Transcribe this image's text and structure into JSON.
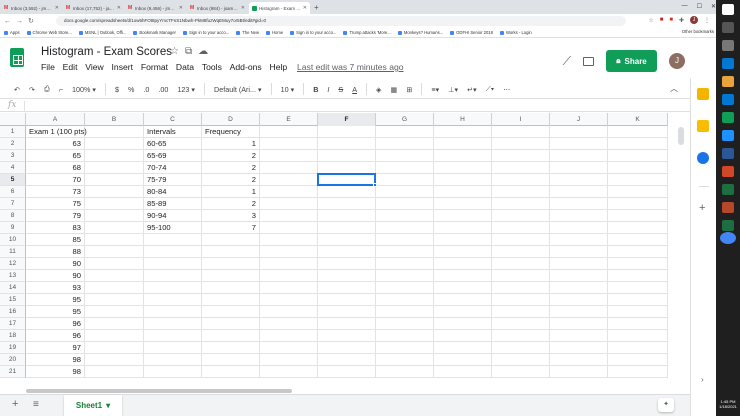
{
  "browser": {
    "tabs": [
      {
        "title": "Inbox (3,592) - jmartin9@easttr...",
        "icon": "M"
      },
      {
        "title": "Inbox (17,752) - jasminson@eas...",
        "icon": "M"
      },
      {
        "title": "Inbox (9,456) - jmartin9@easttr...",
        "icon": "M"
      },
      {
        "title": "Inbox (984) - jsam.martin@ema...",
        "icon": "M"
      },
      {
        "title": "Histogram - Exam Scores - Goo...",
        "icon": "sheets"
      }
    ],
    "new_tab": "+",
    "url": "docs.google.com/spreadsheets/d/1ow5hFOt8pyYmcTFnS1Nbwh-PkM8fuzWqEMuy7or5Bt/edit#gid=0",
    "profile_initial": "J",
    "bookmarks": [
      "Apps",
      "Chrome Web Store...",
      "MSNL | Outlook, Offi...",
      "Bookmark Manager",
      "Sign in to your acco...",
      "The New",
      "Home",
      "Sign in to your acco...",
      "Trump attacks 'More...",
      "Monkeys? Humans...",
      "ODFHI Senior 2018",
      "Works - Login"
    ],
    "other_bookmarks": "Other bookmarks"
  },
  "doc": {
    "title": "Histogram - Exam Scores",
    "menu": [
      "File",
      "Edit",
      "View",
      "Insert",
      "Format",
      "Data",
      "Tools",
      "Add-ons",
      "Help"
    ],
    "last_edit": "Last edit was 7 minutes ago",
    "share_label": "Share",
    "avatar_initial": "J"
  },
  "toolbar": {
    "zoom": "100%",
    "currency": "$",
    "percent": "%",
    "dec_less": ".0",
    "dec_more": ".00",
    "format_more": "123",
    "font": "Default (Ari...",
    "font_size": "10",
    "bold": "B",
    "italic": "I",
    "strike": "S",
    "text_color": "A"
  },
  "formula_bar": {
    "fx": "fx",
    "value": ""
  },
  "grid": {
    "columns": [
      "A",
      "B",
      "C",
      "D",
      "E",
      "F",
      "G",
      "H",
      "I",
      "J",
      "K"
    ],
    "selected_column": "F",
    "selected_row": "5",
    "rows": [
      {
        "n": "1",
        "A": "Exam 1 (100 pts)",
        "C": "Intervals",
        "D": "Frequency"
      },
      {
        "n": "2",
        "A": "63",
        "C": "60-65",
        "D": "1"
      },
      {
        "n": "3",
        "A": "65",
        "C": "65-69",
        "D": "2"
      },
      {
        "n": "4",
        "A": "68",
        "C": "70-74",
        "D": "2"
      },
      {
        "n": "5",
        "A": "70",
        "C": "75-79",
        "D": "2"
      },
      {
        "n": "6",
        "A": "73",
        "C": "80-84",
        "D": "1"
      },
      {
        "n": "7",
        "A": "75",
        "C": "85-89",
        "D": "2"
      },
      {
        "n": "8",
        "A": "79",
        "C": "90-94",
        "D": "3"
      },
      {
        "n": "9",
        "A": "83",
        "C": "95-100",
        "D": "7"
      },
      {
        "n": "10",
        "A": "85"
      },
      {
        "n": "11",
        "A": "88"
      },
      {
        "n": "12",
        "A": "90"
      },
      {
        "n": "13",
        "A": "90"
      },
      {
        "n": "14",
        "A": "93"
      },
      {
        "n": "15",
        "A": "95"
      },
      {
        "n": "16",
        "A": "95"
      },
      {
        "n": "17",
        "A": "96"
      },
      {
        "n": "18",
        "A": "96"
      },
      {
        "n": "19",
        "A": "97"
      },
      {
        "n": "20",
        "A": "98"
      },
      {
        "n": "21",
        "A": "98"
      }
    ]
  },
  "sheets": {
    "add": "+",
    "all": "≡",
    "tabs": [
      {
        "name": "Sheet1",
        "active": true
      }
    ]
  },
  "taskbar": {
    "time": "1:45 PM",
    "date": "1/18/2021"
  },
  "colors": {
    "sheets_green": "#0f9d58",
    "selection_blue": "#1a73e8",
    "active_sheet_text": "#188038"
  }
}
